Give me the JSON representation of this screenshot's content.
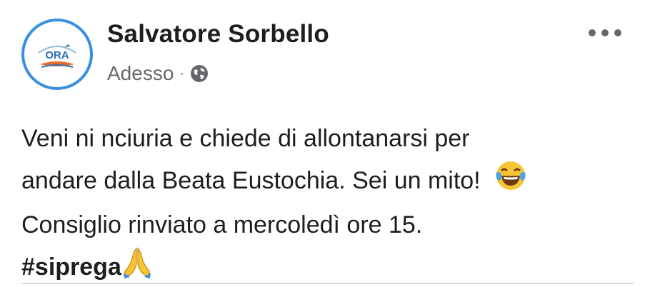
{
  "post": {
    "author": "Salvatore Sorbello",
    "timestamp": "Adesso",
    "separator": "·",
    "privacy_icon": "globe-icon",
    "avatar_text": "ORA",
    "more_icon": "more-options-icon",
    "text_lines": [
      "Veni ni nciuria e chiede di allontanarsi per",
      "andare dalla Beata Eustochia. Sei un mito!",
      "Consiglio rinviato a mercoledì ore 15."
    ],
    "hashtag": "#siprega",
    "emojis": {
      "laugh": "face-with-tears-of-joy-icon",
      "pray": "folded-hands-icon"
    }
  },
  "colors": {
    "author": "#1c1e21",
    "meta": "#65676b",
    "avatar_ring": "#3b8fe0",
    "divider": "#d8dadf"
  }
}
